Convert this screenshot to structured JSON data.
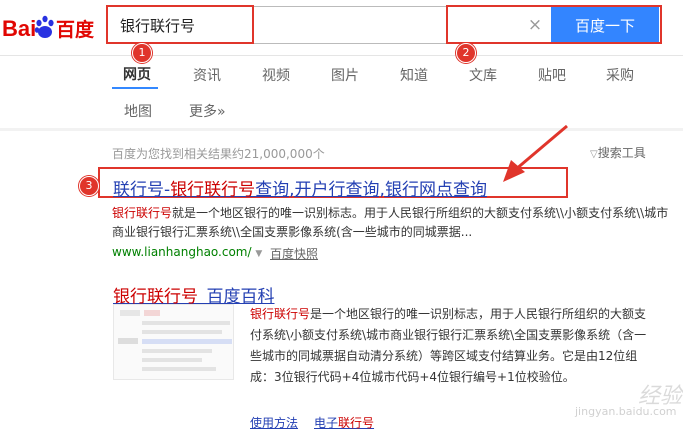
{
  "logo": {
    "left": "Bai",
    "right": "百度"
  },
  "search": {
    "query": "银行联行号",
    "button_label": "百度一下",
    "clear_glyph": "×"
  },
  "badges": [
    "1",
    "2",
    "3"
  ],
  "tabs": [
    "网页",
    "资讯",
    "视频",
    "图片",
    "知道",
    "文库",
    "贴吧",
    "采购",
    "地图",
    "更多»"
  ],
  "results": {
    "count_text": "百度为您找到相关结果约21,000,000个",
    "search_tools": "搜索工具",
    "r1": {
      "title_parts": [
        "联行号-",
        "银行联行号",
        "查询,开户行查询,银行网点查询"
      ],
      "abstract_hl": "银行联行号",
      "abstract": "就是一个地区银行的唯一识别标志。用于人民银行所组织的大额支付系统\\\\小额支付系统\\\\城市商业银行银行汇票系统\\\\全国支票影像系统(含一些城市的同城票据...",
      "url": "www.lianhanghao.com/",
      "cache": "百度快照"
    },
    "r2": {
      "title_parts": [
        "银行联行号",
        "_百度百科"
      ],
      "abstract_hl": "银行联行号",
      "abstract": "是一个地区银行的唯一识别标志，用于人民银行所组织的大额支付系统\\小额支付系统\\城市商业银行银行汇票系统\\全国支票影像系统（含一些城市的同城票据自动清分系统）等跨区域支付结算业务。它是由12位组成：3位银行代码+4位城市代码+4位银行编号+1位校验位。",
      "link1": "使用方法",
      "link2_prefix": "电子",
      "link2_hl": "联行号"
    }
  },
  "watermark": {
    "main": "经验",
    "sub": "jingyan.baidu.com"
  },
  "colors": {
    "accent": "#3385ff",
    "highlight": "#c00",
    "annotation": "#e0352b",
    "link": "#2440b3",
    "url": "#008000"
  }
}
